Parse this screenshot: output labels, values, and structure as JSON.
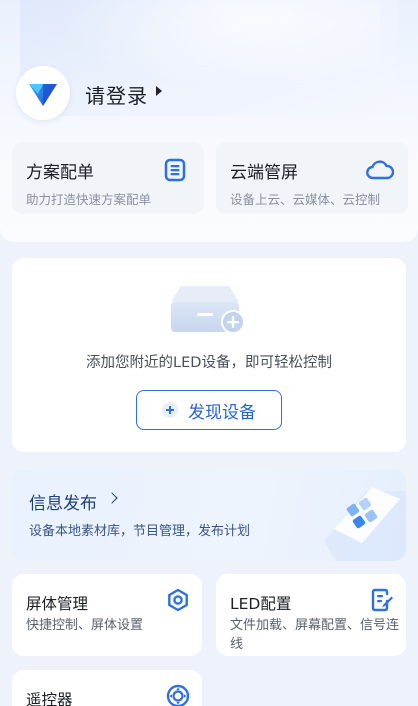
{
  "header": {
    "login_label": "请登录"
  },
  "quick_cards": [
    {
      "title": "方案配单",
      "subtitle": "助力打造快速方案配单",
      "icon": "document-list-icon"
    },
    {
      "title": "云端管屏",
      "subtitle": "设备上云、云媒体、云控制",
      "icon": "cloud-icon"
    }
  ],
  "device": {
    "empty_text": "添加您附近的LED设备，即可轻松控制",
    "discover_label": "发现设备"
  },
  "info_publish": {
    "title": "信息发布",
    "subtitle": "设备本地素材库，节目管理，发布计划"
  },
  "tiles": [
    {
      "title": "屏体管理",
      "subtitle": "快捷控制、屏体设置",
      "icon": "screen-settings-icon"
    },
    {
      "title": "LED配置",
      "subtitle": "文件加载、屏幕配置、信号连线",
      "icon": "config-edit-icon"
    },
    {
      "title": "遥控器",
      "subtitle": "",
      "icon": "remote-control-icon"
    }
  ],
  "colors": {
    "accent": "#2f6fe0",
    "background": "#eef3fb"
  }
}
